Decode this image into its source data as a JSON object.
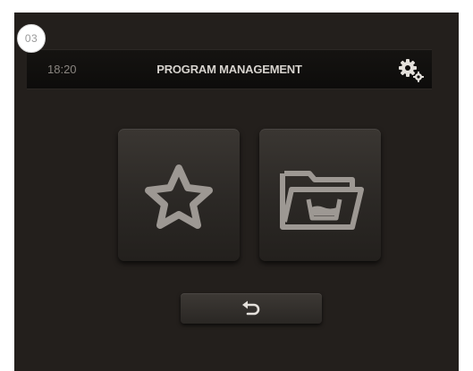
{
  "step_badge": "03",
  "header": {
    "time": "18:20",
    "title": "PROGRAM MANAGEMENT",
    "settings_icon": "gears-icon"
  },
  "tiles": [
    {
      "icon": "star-icon"
    },
    {
      "icon": "folder-with-tub-icon"
    }
  ],
  "footer": {
    "back_icon": "back-arrow-icon"
  },
  "colors": {
    "background": "#231f1c",
    "header_bar": "#0f0d0c",
    "tile": "#2f2b28",
    "icon": "#9d9893",
    "text": "#d7d3ce"
  }
}
